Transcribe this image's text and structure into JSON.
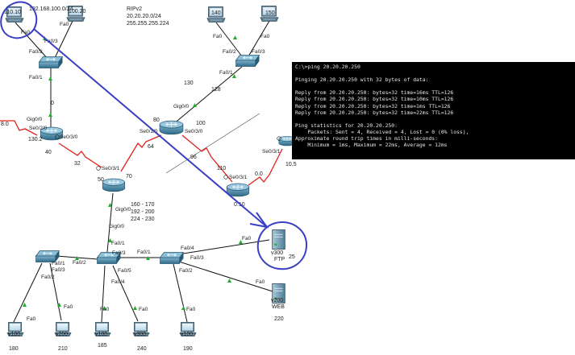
{
  "network_labels": {
    "top_left_pc": "110.10",
    "top_left_network": "192.168.100.0/24",
    "top_second_pc": "100.20",
    "rip_title": "RIPv2",
    "rip_network": "20.20.20.0/24",
    "rip_mask": "255.255.255.224",
    "pc_140": "140",
    "pc_150": "150",
    "num_130": "130",
    "num_128": "128",
    "num_80": "80",
    "num_100": "100",
    "num_0": "0",
    "num_64": "64",
    "num_96": "96",
    "num_110": "110",
    "num_40": "40",
    "num_32": "32",
    "num_50": "50",
    "num_70": "70",
    "num_8": "8.0",
    "num_130_2": "130.2",
    "num_0_0": "0.0",
    "num_0_10": "0.10",
    "num_10_5": "10.5",
    "vlan_range_1": "160 - 170",
    "vlan_range_2": "192 - 200",
    "vlan_range_3": "224 - 230",
    "v300_name": "v300",
    "ftp_name": "FTP",
    "num_25": "25",
    "v200_name": "v200",
    "web_name": "WEB",
    "num_220": "220",
    "v100_1": "v100",
    "num_180": "180",
    "v200_2": "v200",
    "num_210": "210",
    "v100_3": "v100",
    "num_185": "185",
    "v300_4": "v300",
    "num_240": "240",
    "v100_5": "v100",
    "num_190": "190"
  },
  "port_labels": {
    "fa0_a": "Fa0",
    "fa0_b": "Fa0",
    "fa0_2_a": "Fa0/2",
    "fa0_3_a": "Fa0/3",
    "fa0_1_a": "Fa0/1",
    "gig0_0_a": "Gig0/0",
    "se0_2_0": "Se0/2/0",
    "se0_3_0_a": "Se0/3/0",
    "se0_3_1_a": "Se0/3/1",
    "gig0_0_b": "Gig0/0",
    "fa0_c": "Fa0",
    "fa0_d": "Fa0",
    "fa0_2_b": "Fa0/2",
    "fa0_3_b": "Fa0/3",
    "fa0_1_b": "Fa0/1",
    "gig0_0_c": "Gig0/0",
    "se0_1_0": "Se0/1/0",
    "se0_3_0_b": "Se0/3/0",
    "se0_3_1_b": "Se0/3/1",
    "se0_3_1_c": "Se0/3/1",
    "gig0_0_d": "Gig0/0",
    "fa0_1_c": "Fa0/1",
    "fa0_3_c": "Fa0/3",
    "fa0_2_c": "Fa0/2",
    "fa0_1_d": "Fa0/1",
    "fa0_3_d": "Fa0/3",
    "fa0_1_e": "Fa0/1",
    "fa0_4_a": "Fa0/4",
    "fa0_5": "Fa0/5",
    "fa0_4_b": "Fa0/4",
    "fa0_3_e": "Fa0/3",
    "fa0_2_d": "Fa0/2",
    "fa0_2_e": "Fa0/2",
    "fa0_e": "Fa0",
    "fa0_f": "Fa0",
    "fa0_g": "Fa0",
    "fa0_h": "Fa0",
    "fa0_i": "Fa0",
    "fa0_j": "Fa0",
    "fa0_k": "Fa0"
  },
  "console": {
    "lines": [
      "C:\\>ping 20.20.20.250",
      "",
      "Pinging 20.20.20.250 with 32 bytes of data:",
      "",
      "Reply from 20.20.20.250: bytes=32 time=16ms TTL=126",
      "Reply from 20.20.20.250: bytes=32 time=10ms TTL=126",
      "Reply from 20.20.20.250: bytes=32 time=1ms TTL=126",
      "Reply from 20.20.20.250: bytes=32 time=22ms TTL=126",
      "",
      "Ping statistics for 20.20.20.250:",
      "    Packets: Sent = 4, Received = 4, Lost = 0 (0% loss),",
      "Approximate round trip times in milli-seconds:",
      "    Minimum = 1ms, Maximum = 22ms, Average = 12ms"
    ]
  },
  "colors": {
    "annotation": "#3a3fc4",
    "serial_link": "#e0201c",
    "ethernet_link": "#111111",
    "link_up": "#1fae2a",
    "device_blue": "#3c7a99",
    "console_bg": "#000000",
    "console_text": "#e8e8e8"
  }
}
